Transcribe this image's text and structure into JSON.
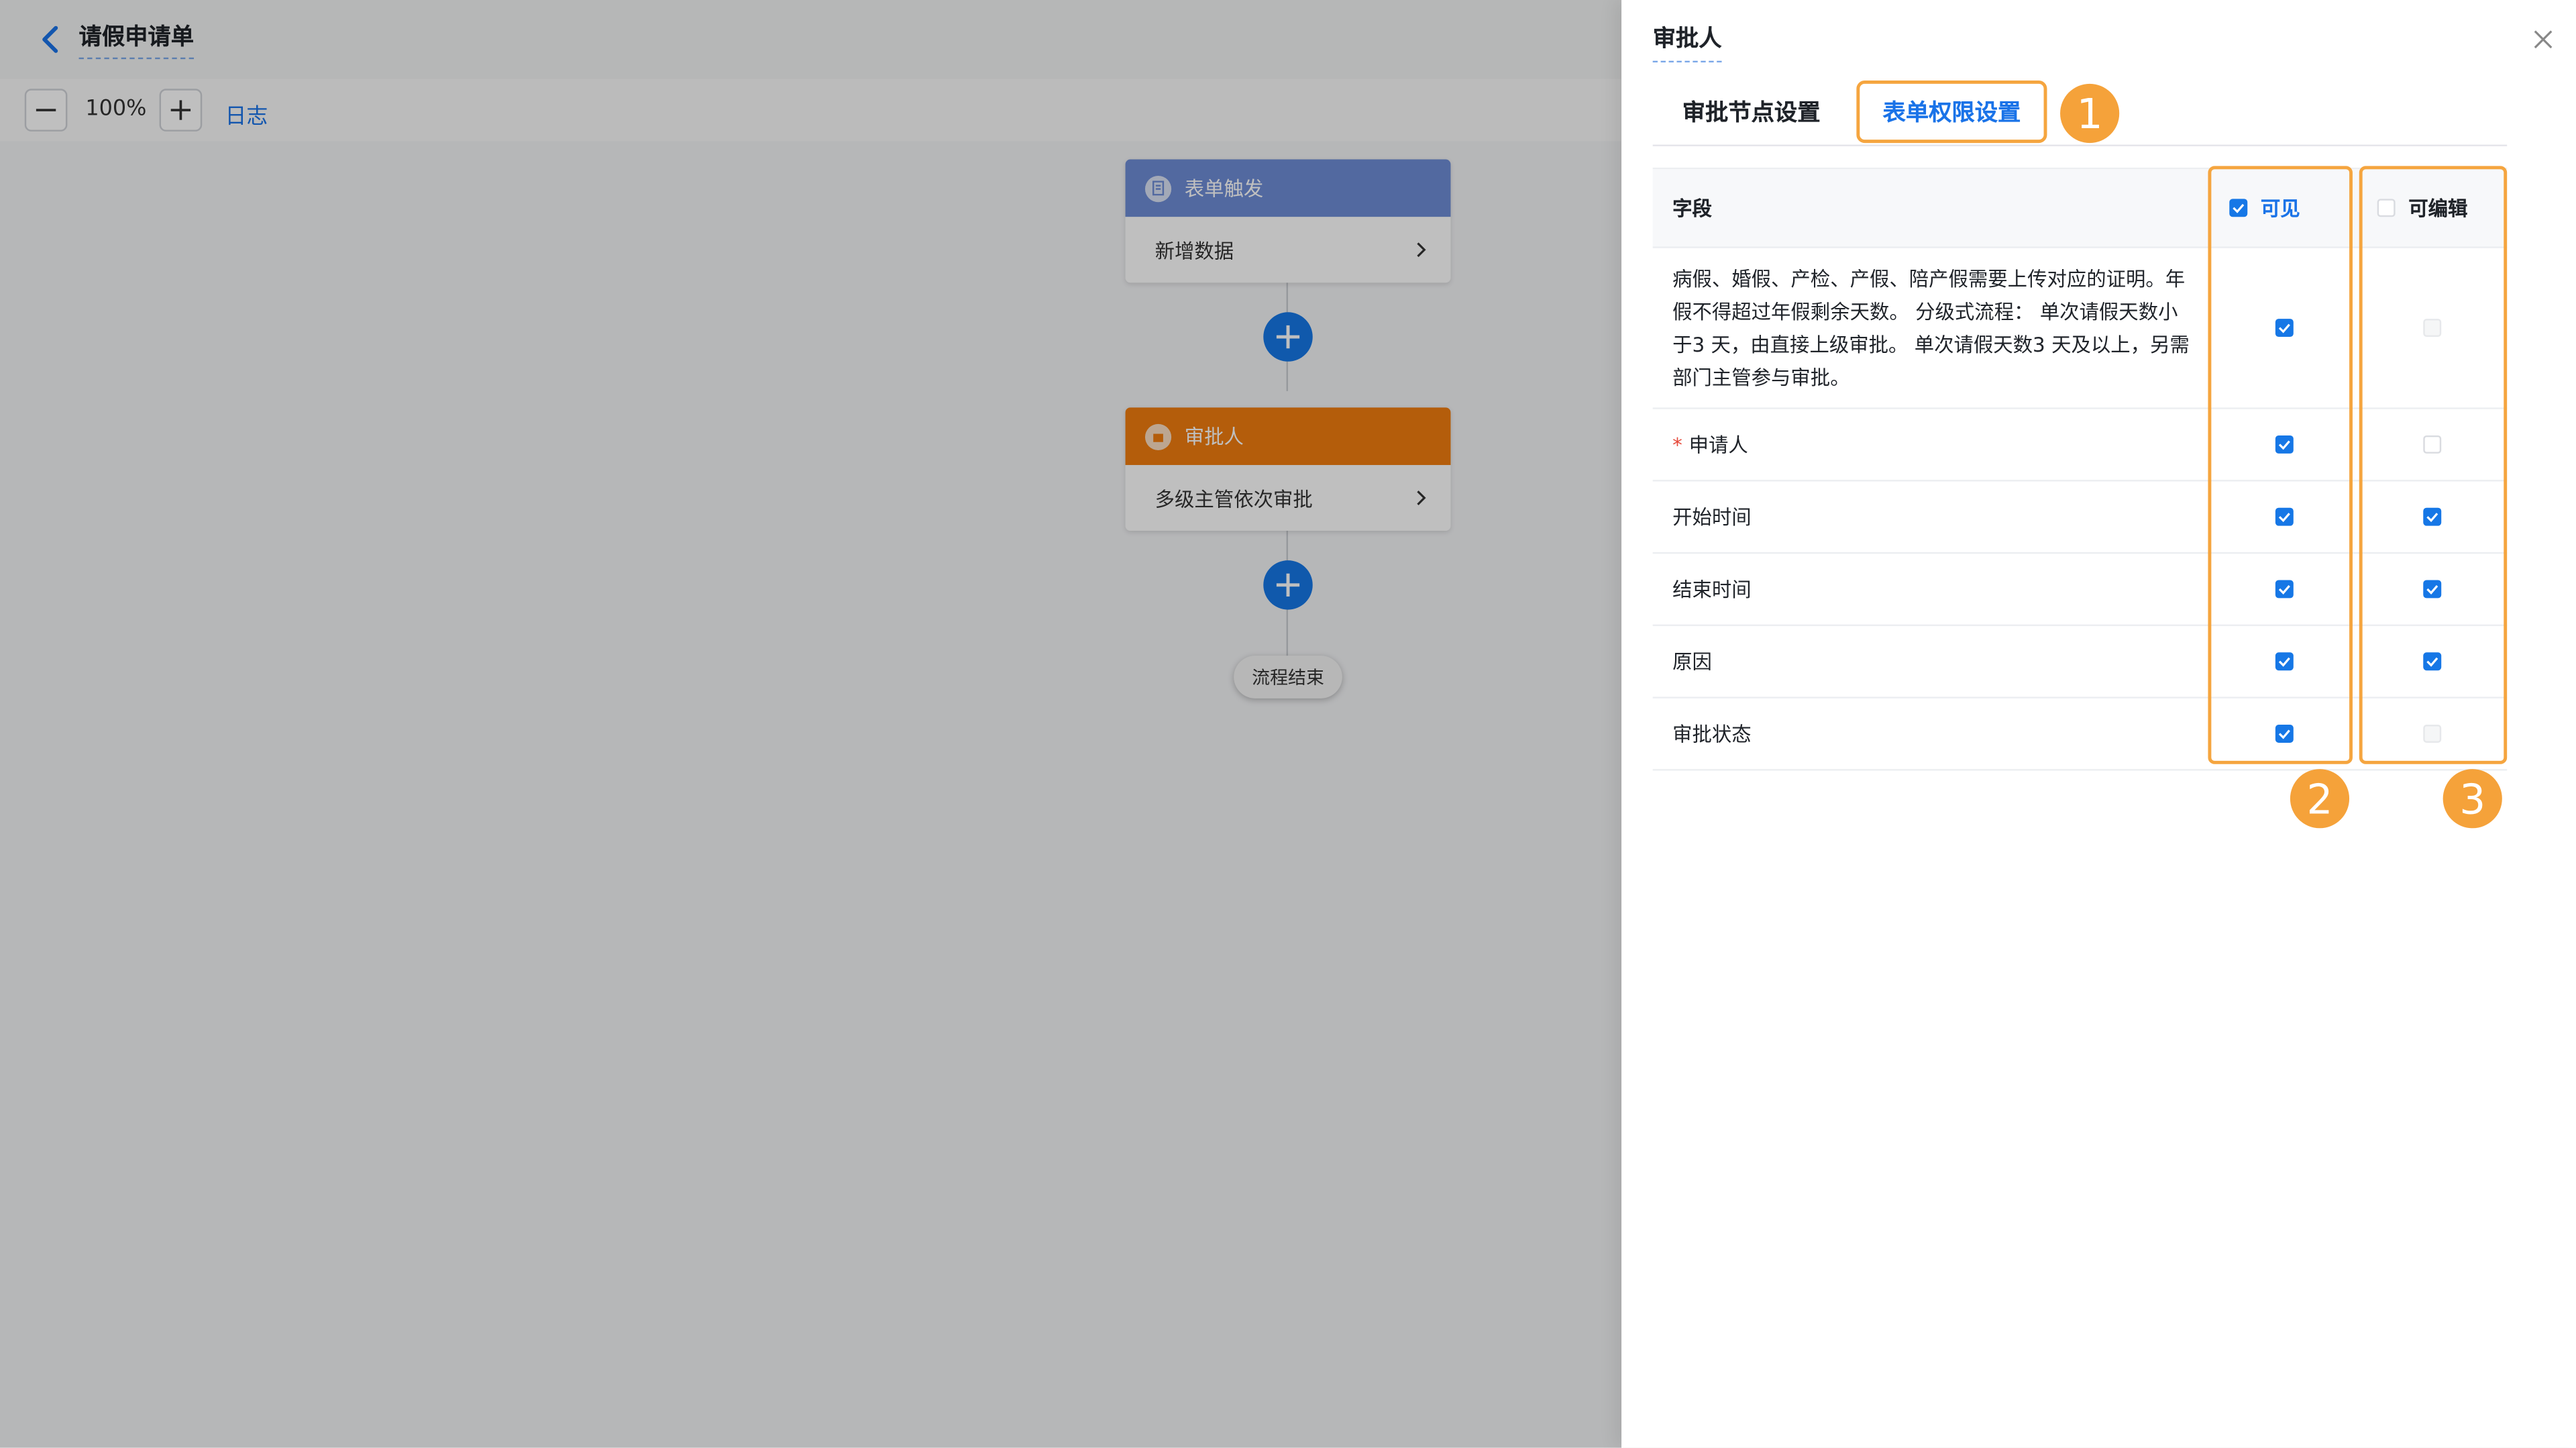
{
  "header": {
    "title": "请假申请单"
  },
  "toolbar": {
    "zoom": "100%",
    "log_label": "日志"
  },
  "flow": {
    "node1": {
      "title": "表单触发",
      "body": "新增数据",
      "color": "#6e8cd6"
    },
    "node2": {
      "title": "审批人",
      "body": "多级主管依次审批",
      "color": "#f07c0f"
    },
    "end_label": "流程结束"
  },
  "panel": {
    "title": "审批人",
    "tabs": [
      "审批节点设置",
      "表单权限设置"
    ],
    "active_tab": "表单权限设置",
    "columns": {
      "field": "字段",
      "visible": "可见",
      "editable": "可编辑"
    },
    "rows": [
      {
        "label": "病假、婚假、产检、产假、陪产假需要上传对应的证明。年假不得超过年假剩余天数。 分级式流程： 单次请假天数小于3 天，由直接上级审批。 单次请假天数3 天及以上，另需部门主管参与审批。",
        "required": false,
        "visible": true,
        "editable": "disabled"
      },
      {
        "label": "申请人",
        "required": true,
        "visible": true,
        "editable": false
      },
      {
        "label": "开始时间",
        "required": false,
        "visible": true,
        "editable": true
      },
      {
        "label": "结束时间",
        "required": false,
        "visible": true,
        "editable": true
      },
      {
        "label": "原因",
        "required": false,
        "visible": true,
        "editable": true
      },
      {
        "label": "审批状态",
        "required": false,
        "visible": true,
        "editable": "disabled"
      }
    ],
    "badges": [
      "1",
      "2",
      "3"
    ]
  },
  "colors": {
    "accent": "#1677e6",
    "highlight": "#f5a53f"
  }
}
